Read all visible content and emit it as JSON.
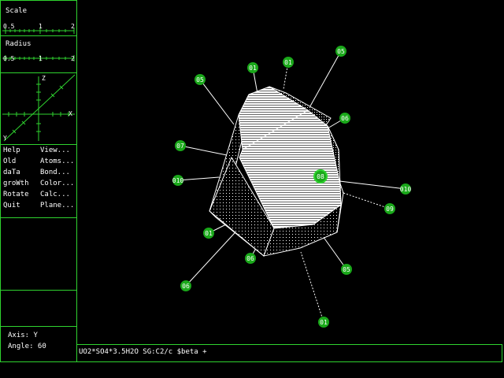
{
  "sidebar": {
    "scale": {
      "label": "Scale",
      "ticks": [
        "0.5",
        "1",
        "2"
      ]
    },
    "radius": {
      "label": "Radius",
      "ticks": [
        "0.5",
        "1",
        "2"
      ]
    },
    "axes": {
      "z": "Z",
      "x": "X",
      "y": "Y"
    },
    "menu_left": [
      "Help",
      "Old",
      "daTa",
      "groWth",
      "Rotate",
      "Quit"
    ],
    "menu_right": [
      "View...",
      "Atoms...",
      "Bond...",
      "Color...",
      "Calc...",
      "Plane..."
    ],
    "status": {
      "axis": "Axis: Y",
      "angle": "Angle: 60"
    }
  },
  "command_line": "UO2*SO4*3.5H2O SG:C2/c $beta +",
  "model": {
    "face_labels": [
      "01",
      "01",
      "05",
      "05",
      "06",
      "07",
      "010",
      "08",
      "010",
      "09",
      "01",
      "06",
      "06",
      "05",
      "01"
    ],
    "colors": {
      "accent": "#2fd32f",
      "label_fill": "#1aa81a",
      "background": "#000000",
      "text": "#ffffff"
    }
  }
}
